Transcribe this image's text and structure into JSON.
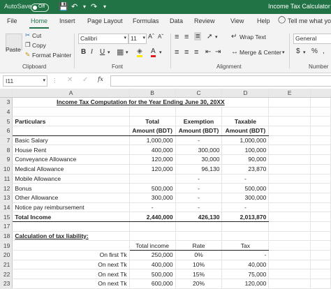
{
  "titlebar": {
    "autosave": "AutoSave",
    "toggle": "Off",
    "title": "Income Tax Calculator - E"
  },
  "tabs": [
    "File",
    "Home",
    "Insert",
    "Page Layout",
    "Formulas",
    "Data",
    "Review",
    "View",
    "Help"
  ],
  "tell_me": "Tell me what you",
  "ribbon": {
    "cut": "Cut",
    "copy": "Copy",
    "format_painter": "Format Painter",
    "paste": "Paste",
    "font_name": "Calibri",
    "font_size": "11",
    "bold": "B",
    "italic": "I",
    "underline": "U",
    "wrap_text": "Wrap Text",
    "merge_center": "Merge & Center",
    "number_format": "General",
    "groups": {
      "clipboard": "Clipboard",
      "font": "Font",
      "alignment": "Alignment",
      "number": "Number"
    }
  },
  "formula_bar": {
    "name_box": "I11",
    "fx": "fx",
    "value": ""
  },
  "columns": [
    "A",
    "B",
    "C",
    "D",
    "E"
  ],
  "rows": [
    {
      "n": "3",
      "a": "Income Tax Computation for the Year Ending June 30, 20XX",
      "b": "",
      "c": "",
      "d": ""
    },
    {
      "n": "4",
      "a": "",
      "b": "",
      "c": "",
      "d": ""
    },
    {
      "n": "5",
      "a": "Particulars",
      "b": "Total",
      "c": "Exemption",
      "d": "Taxable"
    },
    {
      "n": "6",
      "a": "",
      "b": "Amount (BDT)",
      "c": "Amount (BDT)",
      "d": "Amount (BDT)"
    },
    {
      "n": "7",
      "a": "Basic Salary",
      "b": "1,000,000",
      "c": "-",
      "d": "1,000,000"
    },
    {
      "n": "8",
      "a": "House Rent",
      "b": "400,000",
      "c": "300,000",
      "d": "100,000"
    },
    {
      "n": "9",
      "a": "Conveyance Allowance",
      "b": "120,000",
      "c": "30,000",
      "d": "90,000"
    },
    {
      "n": "10",
      "a": "Medical Allowance",
      "b": "120,000",
      "c": "96,130",
      "d": "23,870"
    },
    {
      "n": "11",
      "a": "Mobile Allowance",
      "b": "",
      "c": "-",
      "d": "-"
    },
    {
      "n": "12",
      "a": "Bonus",
      "b": "500,000",
      "c": "-",
      "d": "500,000"
    },
    {
      "n": "13",
      "a": "Other Allowance",
      "b": "300,000",
      "c": "-",
      "d": "300,000"
    },
    {
      "n": "14",
      "a": "Notice pay reimbursement",
      "b": "-",
      "c": "-",
      "d": "-"
    },
    {
      "n": "15",
      "a": "Total Income",
      "b": "2,440,000",
      "c": "426,130",
      "d": "2,013,870"
    },
    {
      "n": "17",
      "a": "",
      "b": "",
      "c": "",
      "d": ""
    },
    {
      "n": "18",
      "a": "Calculation of tax liability:",
      "b": "",
      "c": "",
      "d": ""
    },
    {
      "n": "19",
      "a": "",
      "b": "Total income",
      "c": "Rate",
      "d": "Tax"
    },
    {
      "n": "20",
      "a": "On first Tk",
      "b": "250,000",
      "c": "0%",
      "d": "-"
    },
    {
      "n": "21",
      "a": "On next Tk",
      "b": "400,000",
      "c": "10%",
      "d": "40,000"
    },
    {
      "n": "22",
      "a": "On next Tk",
      "b": "500,000",
      "c": "15%",
      "d": "75,000"
    },
    {
      "n": "23",
      "a": "On next Tk",
      "b": "600,000",
      "c": "20%",
      "d": "120,000"
    }
  ],
  "colors": {
    "excel_green": "#217346"
  }
}
